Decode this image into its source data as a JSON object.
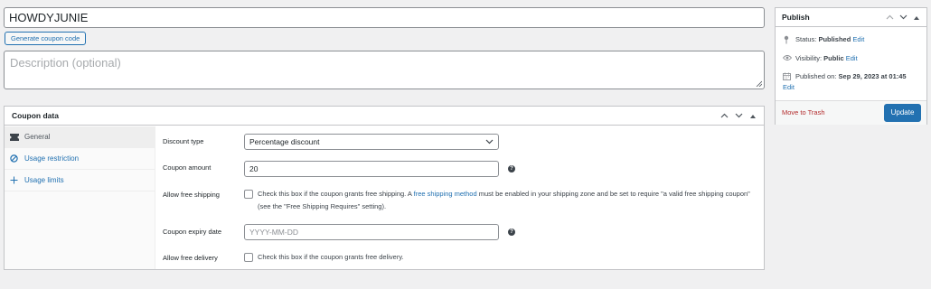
{
  "coupon": {
    "code": "HOWDYJUNIE",
    "generate_label": "Generate coupon code",
    "description_placeholder": "Description (optional)"
  },
  "coupon_data": {
    "title": "Coupon data",
    "tabs": [
      {
        "label": "General",
        "icon": "ticket-icon",
        "active": true
      },
      {
        "label": "Usage restriction",
        "icon": "block-icon"
      },
      {
        "label": "Usage limits",
        "icon": "plus-icon"
      }
    ],
    "fields": {
      "discount_type_label": "Discount type",
      "discount_type_value": "Percentage discount",
      "amount_label": "Coupon amount",
      "amount_value": "20",
      "free_shipping_label": "Allow free shipping",
      "free_shipping_text_1": "Check this box if the coupon grants free shipping. A ",
      "free_shipping_link": "free shipping method",
      "free_shipping_text_2": " must be enabled in your shipping zone and be set to require \"a valid free shipping coupon\" (see the \"Free Shipping Requires\" setting).",
      "expiry_label": "Coupon expiry date",
      "expiry_placeholder": "YYYY-MM-DD",
      "free_delivery_label": "Allow free delivery",
      "free_delivery_text": "Check this box if the coupon grants free delivery."
    }
  },
  "publish": {
    "title": "Publish",
    "status_label": "Status: ",
    "status_value": "Published",
    "visibility_label": "Visibility: ",
    "visibility_value": "Public",
    "published_label": "Published on: ",
    "published_value": "Sep 29, 2023 at 01:45",
    "edit_label": "Edit",
    "trash_label": "Move to Trash",
    "update_label": "Update"
  },
  "colors": {
    "accent": "#2271b1",
    "danger": "#b32d2e",
    "background": "#f0f0f1"
  }
}
